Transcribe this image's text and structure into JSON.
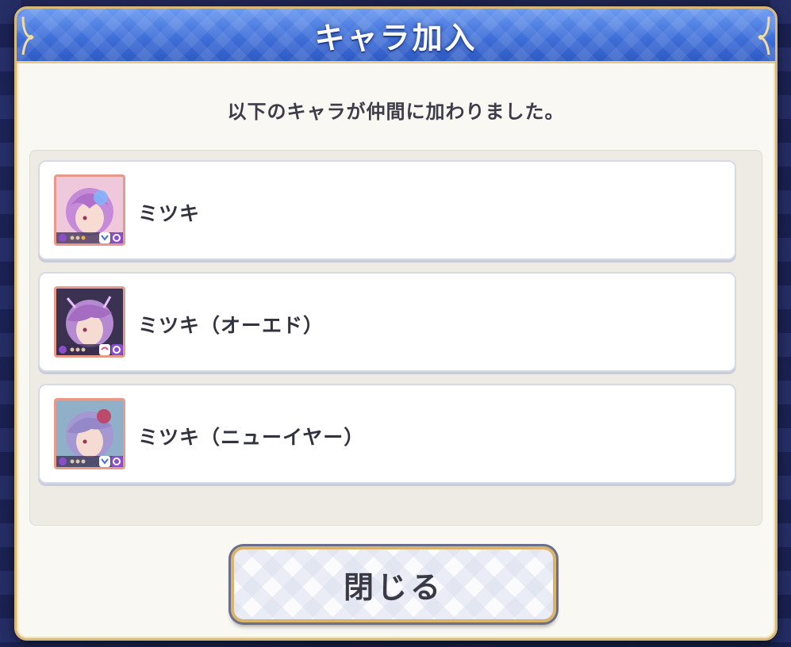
{
  "dialog": {
    "title": "キャラ加入",
    "message": "以下のキャラが仲間に加わりました。",
    "close_label": "閉じる"
  },
  "characters": [
    {
      "name": "ミツキ",
      "hair_color": "#c58ad8",
      "accent": "#7fb6ff",
      "icon": "character-portrait"
    },
    {
      "name": "ミツキ（オーエド）",
      "hair_color": "#b58ad0",
      "accent": "#e6c0ff",
      "icon": "character-portrait"
    },
    {
      "name": "ミツキ（ニューイヤー）",
      "hair_color": "#a497d2",
      "accent": "#c04060",
      "icon": "character-portrait"
    }
  ],
  "colors": {
    "header_blue": "#3f6fd8",
    "frame_gold": "#d9b978",
    "portrait_border": "#e79a8a",
    "class_badge": "#8a4ec9"
  }
}
